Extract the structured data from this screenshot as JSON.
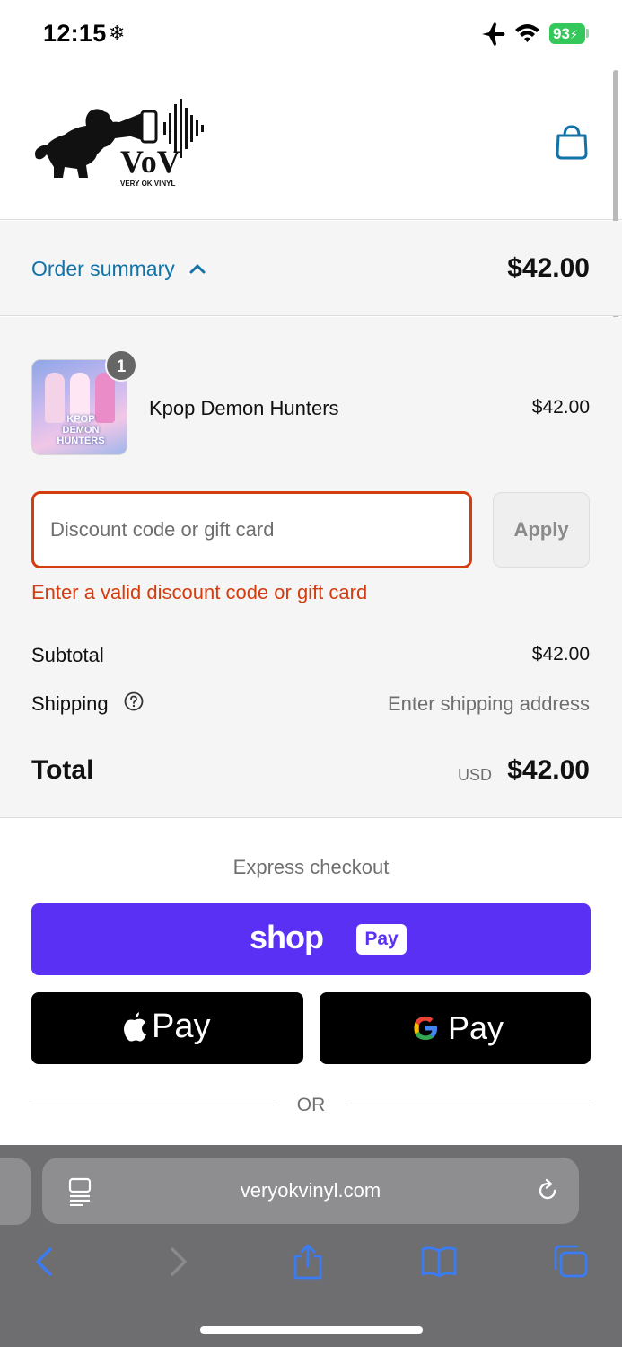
{
  "status_bar": {
    "time": "12:15",
    "battery": "93"
  },
  "header": {
    "logo_text": "VoV",
    "logo_subtext": "VERY OK VINYL"
  },
  "summary": {
    "toggle_label": "Order summary",
    "total": "$42.00"
  },
  "line_item": {
    "quantity": "1",
    "name": "Kpop Demon Hunters",
    "price": "$42.00",
    "thumb_text": "KPOP DEMON HUNTERS"
  },
  "discount": {
    "placeholder": "Discount code or gift card",
    "apply_label": "Apply",
    "error": "Enter a valid discount code or gift card"
  },
  "costs": {
    "subtotal_label": "Subtotal",
    "subtotal_value": "$42.00",
    "shipping_label": "Shipping",
    "shipping_value": "Enter shipping address",
    "total_label": "Total",
    "currency": "USD",
    "total_value": "$42.00"
  },
  "express": {
    "title": "Express checkout",
    "shop_word": "shop",
    "shop_pill": "Pay",
    "apple_label": "Pay",
    "google_label": "Pay",
    "or_label": "OR"
  },
  "browser": {
    "url": "veryokvinyl.com"
  },
  "colors": {
    "accent": "#1173a8",
    "error": "#d43d0f",
    "shop_pay": "#5a31f4"
  }
}
